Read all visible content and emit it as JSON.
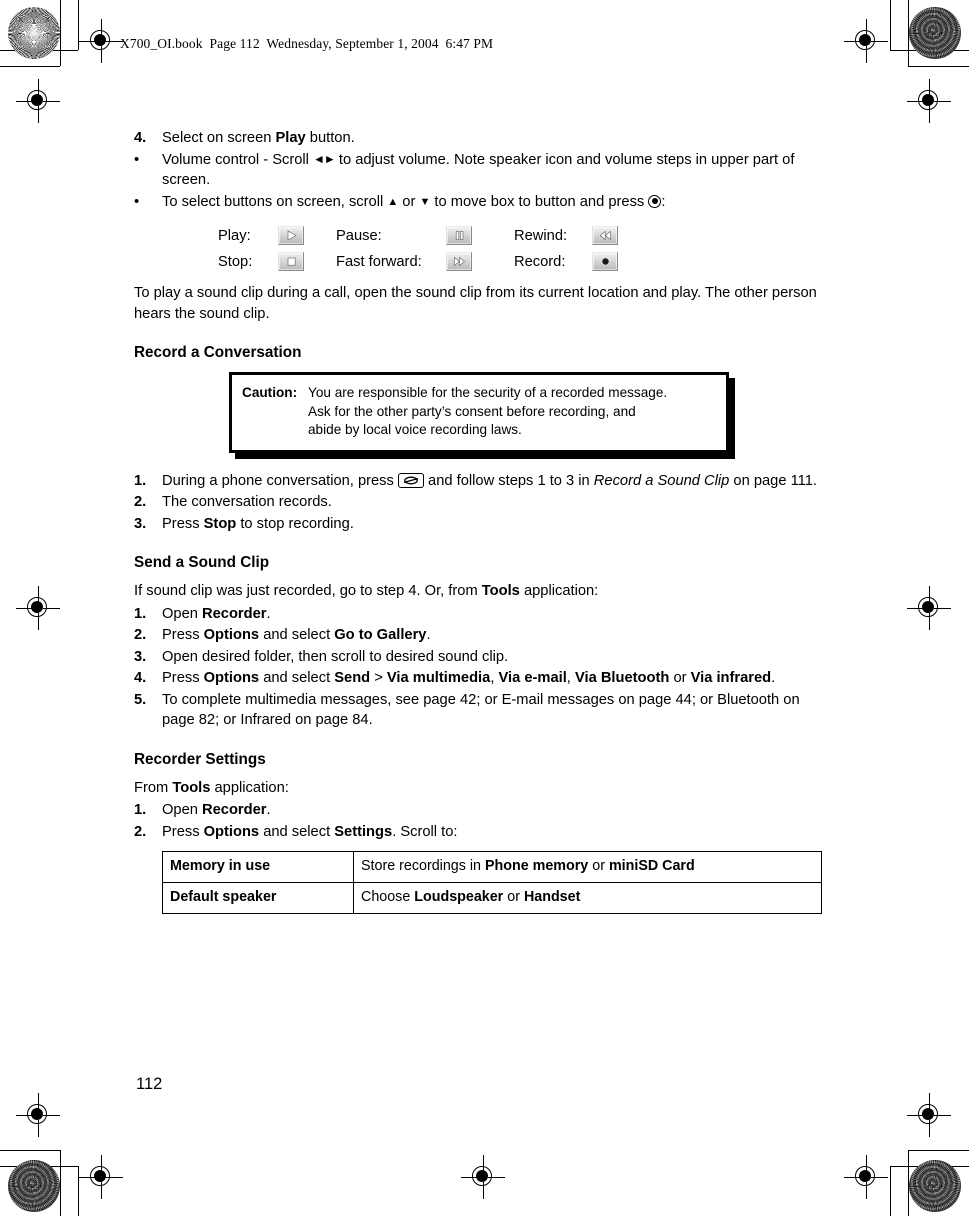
{
  "page_header": "X700_OI.book  Page 112  Wednesday, September 1, 2004  6:47 PM",
  "page_number": "112",
  "steps_top": {
    "step4": {
      "marker": "4.",
      "text_1": "Select on screen ",
      "bold_1": "Play",
      "text_2": " button."
    },
    "bullet1": {
      "marker": "•",
      "text_1": "Volume control - Scroll ",
      "icon": "left-right-arrows-icon",
      "text_2": " to adjust volume. Note speaker icon and volume steps in upper part of screen."
    },
    "bullet2": {
      "marker": "•",
      "text_1": "To select buttons on screen, scroll ",
      "icon_up": "up-arrow-icon",
      "text_2": " or ",
      "icon_down": "down-arrow-icon",
      "text_3": " to move box to button and press ",
      "icon_select": "center-select-key-icon",
      "text_4": ":"
    }
  },
  "button_legend": [
    {
      "label": "Play:",
      "icon": "play-icon"
    },
    {
      "label": "Pause:",
      "icon": "pause-icon"
    },
    {
      "label": "Rewind:",
      "icon": "rewind-icon"
    },
    {
      "label": "Stop:",
      "icon": "stop-icon"
    },
    {
      "label": "Fast forward:",
      "icon": "fast-forward-icon"
    },
    {
      "label": "Record:",
      "icon": "record-icon"
    }
  ],
  "sound_clip_paragraph": "To play a sound clip during a call, open the sound clip from its current location and play. The other person hears the sound clip.",
  "record_conversation": {
    "heading": "Record a Conversation",
    "caution": {
      "label": "Caution",
      "colon": ":",
      "line1": "You are responsible for the security of a recorded message.",
      "line2": "Ask for the other party’s consent before recording, and",
      "line3": "abide by local voice recording laws."
    },
    "steps": [
      {
        "marker": "1.",
        "text_1": "During a phone conversation, press ",
        "icon": "record-hardware-key-icon",
        "text_2": " and follow steps 1 to 3 in ",
        "italic_1": "Record a Sound Clip",
        "text_3": " on page 111."
      },
      {
        "marker": "2.",
        "text_1": "The conversation records."
      },
      {
        "marker": "3.",
        "text_1": "Press ",
        "bold_1": "Stop",
        "text_2": " to stop recording."
      }
    ]
  },
  "send_sound_clip": {
    "heading": "Send a Sound Clip",
    "intro_1": "If sound clip was just recorded, go to step 4. Or, from ",
    "intro_bold": "Tools",
    "intro_2": " application:",
    "steps": [
      {
        "marker": "1.",
        "text_1": "Open ",
        "bold_1": "Recorder",
        "text_2": "."
      },
      {
        "marker": "2.",
        "text_1": "Press ",
        "bold_1": "Options",
        "text_2": " and select ",
        "bold_2": "Go to Gallery",
        "text_3": "."
      },
      {
        "marker": "3.",
        "text_1": "Open desired folder, then scroll to desired sound clip."
      },
      {
        "marker": "4.",
        "text_1": "Press ",
        "bold_1": "Options",
        "text_2": " and select ",
        "bold_2": "Send",
        "text_3": " > ",
        "bold_3": "Via multimedia",
        "text_4": ", ",
        "bold_4": "Via e-mail",
        "text_5": ", ",
        "bold_5": "Via Bluetooth",
        "text_6": " or ",
        "bold_6": "Via infrared",
        "text_7": "."
      },
      {
        "marker": "5.",
        "text_1": "To complete multimedia messages, see page 42; or E-mail messages on page 44; or Bluetooth on page 82; or Infrared on page 84."
      }
    ]
  },
  "recorder_settings": {
    "heading": "Recorder Settings",
    "intro_1": "From ",
    "intro_bold": "Tools",
    "intro_2": " application:",
    "steps": [
      {
        "marker": "1.",
        "text_1": "Open ",
        "bold_1": "Recorder",
        "text_2": "."
      },
      {
        "marker": "2.",
        "text_1": "Press ",
        "bold_1": "Options",
        "text_2": " and select ",
        "bold_2": "Settings",
        "text_3": ". Scroll to:"
      }
    ],
    "table": [
      {
        "key": "Memory in use",
        "value_1": "Store recordings in ",
        "value_bold_1": "Phone memory",
        "value_2": " or ",
        "value_bold_2": "miniSD Card",
        "value_3": ""
      },
      {
        "key": "Default speaker",
        "value_1": "Choose ",
        "value_bold_1": "Loudspeaker",
        "value_2": " or ",
        "value_bold_2": "Handset",
        "value_3": ""
      }
    ]
  },
  "print_marks": {
    "registration": "registration-crosshair-mark",
    "patch_light": "halftone-starburst-patch",
    "patch_dark": "halftone-moire-patch"
  }
}
